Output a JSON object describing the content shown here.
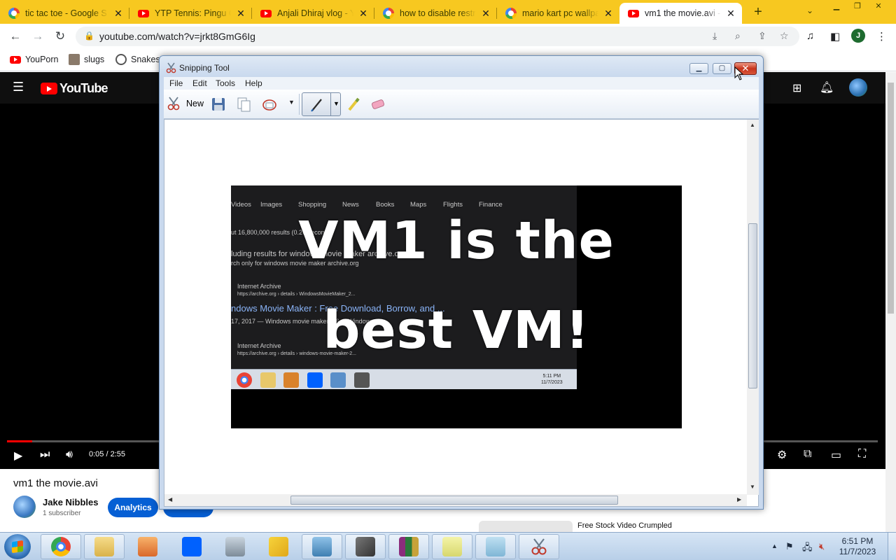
{
  "browser": {
    "tabs": [
      {
        "title": "tic tac toe - Google S",
        "favicon": "google-icon"
      },
      {
        "title": "YTP Tennis: Pingu Go",
        "favicon": "youtube-icon"
      },
      {
        "title": "Anjali Dhiraj vlog - Y",
        "favicon": "youtube-icon"
      },
      {
        "title": "how to disable restri",
        "favicon": "google-icon"
      },
      {
        "title": "mario kart pc wallpa",
        "favicon": "google-icon"
      },
      {
        "title": "vm1 the movie.avi -",
        "favicon": "youtube-icon",
        "active": true
      }
    ],
    "url": "youtube.com/watch?v=jrkt8GmG6Ig",
    "profile_initial": "J",
    "bookmarks": [
      {
        "label": "YouPorn"
      },
      {
        "label": "slugs"
      },
      {
        "label": "Snakes"
      }
    ],
    "accent_color": "#f7c820"
  },
  "youtube": {
    "logo_text": "YouTube",
    "time_display": "0:05 / 2:55",
    "progress_fraction": 0.029,
    "video_title": "vm1 the movie.avi",
    "channel_name": "Jake Nibbles",
    "subscribers": "1 subscriber",
    "analytics_label": "Analytics",
    "recommended_title": "Free Stock Video Crumpled"
  },
  "snipping_tool": {
    "title": "Snipping Tool",
    "menu": [
      "File",
      "Edit",
      "Tools",
      "Help"
    ],
    "new_label": "New",
    "capture": {
      "tabs": [
        "Videos",
        "Images",
        "Shopping",
        "News",
        "Books",
        "Maps",
        "Flights",
        "Finance"
      ],
      "results_line": "ut 16,800,000 results (0.26 seconds)",
      "including_line": "luding results for windows movie maker archive.org",
      "search_only_line": "rch only for windows movie maker archive.org",
      "source1": "Internet Archive",
      "url1": "https://archive.org › details › WindowsMovieMaker_2...",
      "link": "ndows Movie Maker : Free Download, Borrow, and ...",
      "date_line": "17, 2017 — Windows movie maker 2.6 ... Windows ...",
      "source2": "Internet Archive",
      "url2": "https://archive.org › details › windows-movie-maker-2...",
      "clock_time": "5:11 PM",
      "clock_date": "11/7/2023",
      "overlay_line1": "VM1 is the",
      "overlay_line2": "best VM!"
    }
  },
  "taskbar": {
    "clock_time": "6:51 PM",
    "clock_date": "11/7/2023"
  }
}
